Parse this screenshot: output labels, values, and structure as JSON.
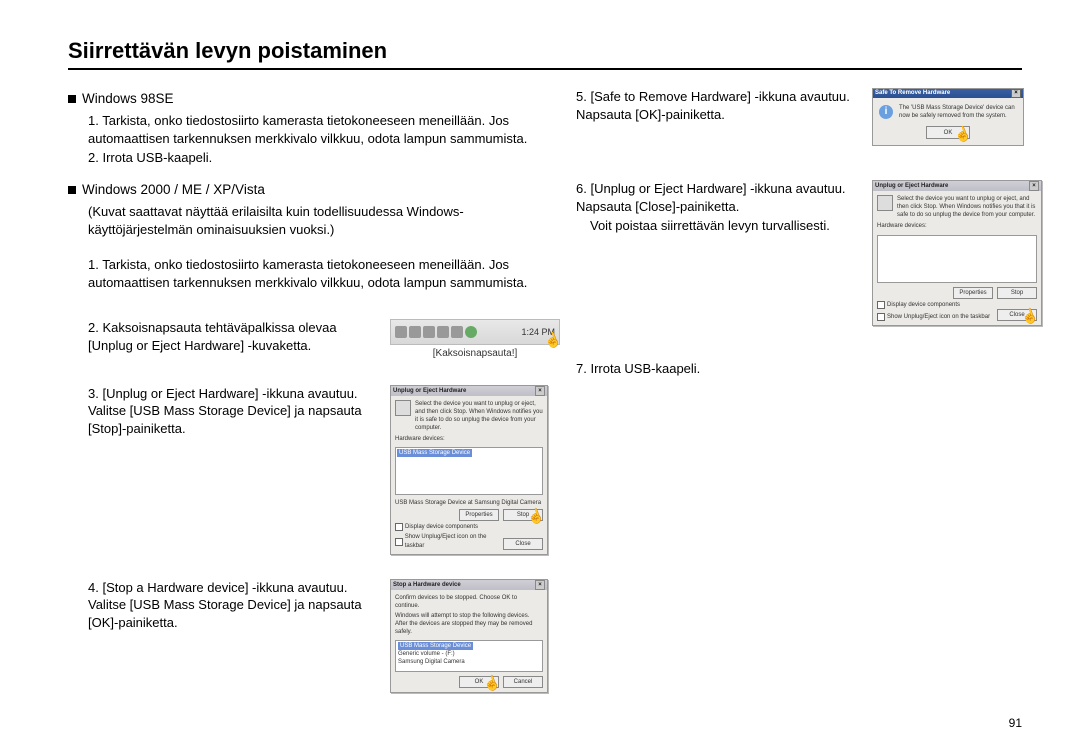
{
  "title": "Siirrettävän levyn poistaminen",
  "page_number": "91",
  "left": {
    "section1": {
      "heading": "Windows 98SE",
      "item1_no": "1.",
      "item1": "Tarkista, onko tiedostosiirto kamerasta tietokoneeseen meneillään. Jos automaattisen tarkennuksen merkkivalo vilkkuu, odota lampun sammumista.",
      "item2_no": "2.",
      "item2": "Irrota USB-kaapeli."
    },
    "section2": {
      "heading": "Windows 2000 / ME / XP/Vista",
      "note": "(Kuvat saattavat näyttää erilaisilta kuin todellisuudessa Windows-käyttöjärjestelmän ominaisuuksien vuoksi.)",
      "item1_no": "1.",
      "item1": "Tarkista, onko tiedostosiirto kamerasta tietokoneeseen meneillään. Jos automaattisen tarkennuksen merkkivalo vilkkuu, odota lampun sammumista.",
      "item2_no": "2.",
      "item2": "Kaksoisnapsauta tehtäväpalkissa olevaa [Unplug or Eject Hardware] -kuvaketta.",
      "tray_time": "1:24 PM",
      "tray_caption": "[Kaksoisnapsauta!]",
      "item3_no": "3.",
      "item3": "[Unplug or Eject Hardware] -ikkuna avautuu. Valitse [USB Mass Storage Device] ja napsauta [Stop]-painiketta.",
      "dlg1_title": "Unplug or Eject Hardware",
      "dlg1_desc": "Select the device you want to unplug or eject, and then click Stop. When Windows notifies you it is safe to do so unplug the device from your computer.",
      "dlg1_hw_label": "Hardware devices:",
      "dlg1_list_item": "USB Mass Storage Device",
      "dlg1_detail": "USB Mass Storage Device at Samsung Digital Camera",
      "dlg1_btn_props": "Properties",
      "dlg1_btn_stop": "Stop",
      "dlg1_chk1": "Display device components",
      "dlg1_chk2": "Show Unplug/Eject icon on the taskbar",
      "dlg1_btn_close": "Close",
      "item4_no": "4.",
      "item4": "[Stop a Hardware device] -ikkuna avautuu. Valitse [USB Mass Storage Device] ja napsauta [OK]-painiketta.",
      "dlg2_title": "Stop a Hardware device",
      "dlg2_desc": "Confirm devices to be stopped. Choose OK to continue.",
      "dlg2_desc2": "Windows will attempt to stop the following devices. After the devices are stopped they may be removed safely.",
      "dlg2_li1": "USB Mass Storage Device",
      "dlg2_li2": "Generic volume - (F:)",
      "dlg2_li3": "Samsung Digital Camera",
      "dlg2_btn_ok": "OK",
      "dlg2_btn_cancel": "Cancel"
    }
  },
  "right": {
    "item5_no": "5.",
    "item5": "[Safe to Remove Hardware] -ikkuna avautuu. Napsauta [OK]-painiketta.",
    "dlg3_title": "Safe To Remove Hardware",
    "dlg3_text": "The 'USB Mass Storage Device' device can now be safely removed from the system.",
    "dlg3_btn_ok": "OK",
    "item6_no": "6.",
    "item6": "[Unplug or Eject Hardware] -ikkuna avautuu. Napsauta [Close]-painiketta.",
    "item6b": "Voit poistaa siirrettävän levyn turvallisesti.",
    "dlg4_title": "Unplug or Eject Hardware",
    "dlg4_desc": "Select the device you want to unplug or eject, and then click Stop. When Windows notifies you that it is safe to do so unplug the device from your computer.",
    "dlg4_hw_label": "Hardware devices:",
    "dlg4_btn_props": "Properties",
    "dlg4_btn_stop": "Stop",
    "dlg4_chk1": "Display device components",
    "dlg4_chk2": "Show Unplug/Eject icon on the taskbar",
    "dlg4_btn_close": "Close",
    "item7_no": "7.",
    "item7": "Irrota USB-kaapeli."
  }
}
